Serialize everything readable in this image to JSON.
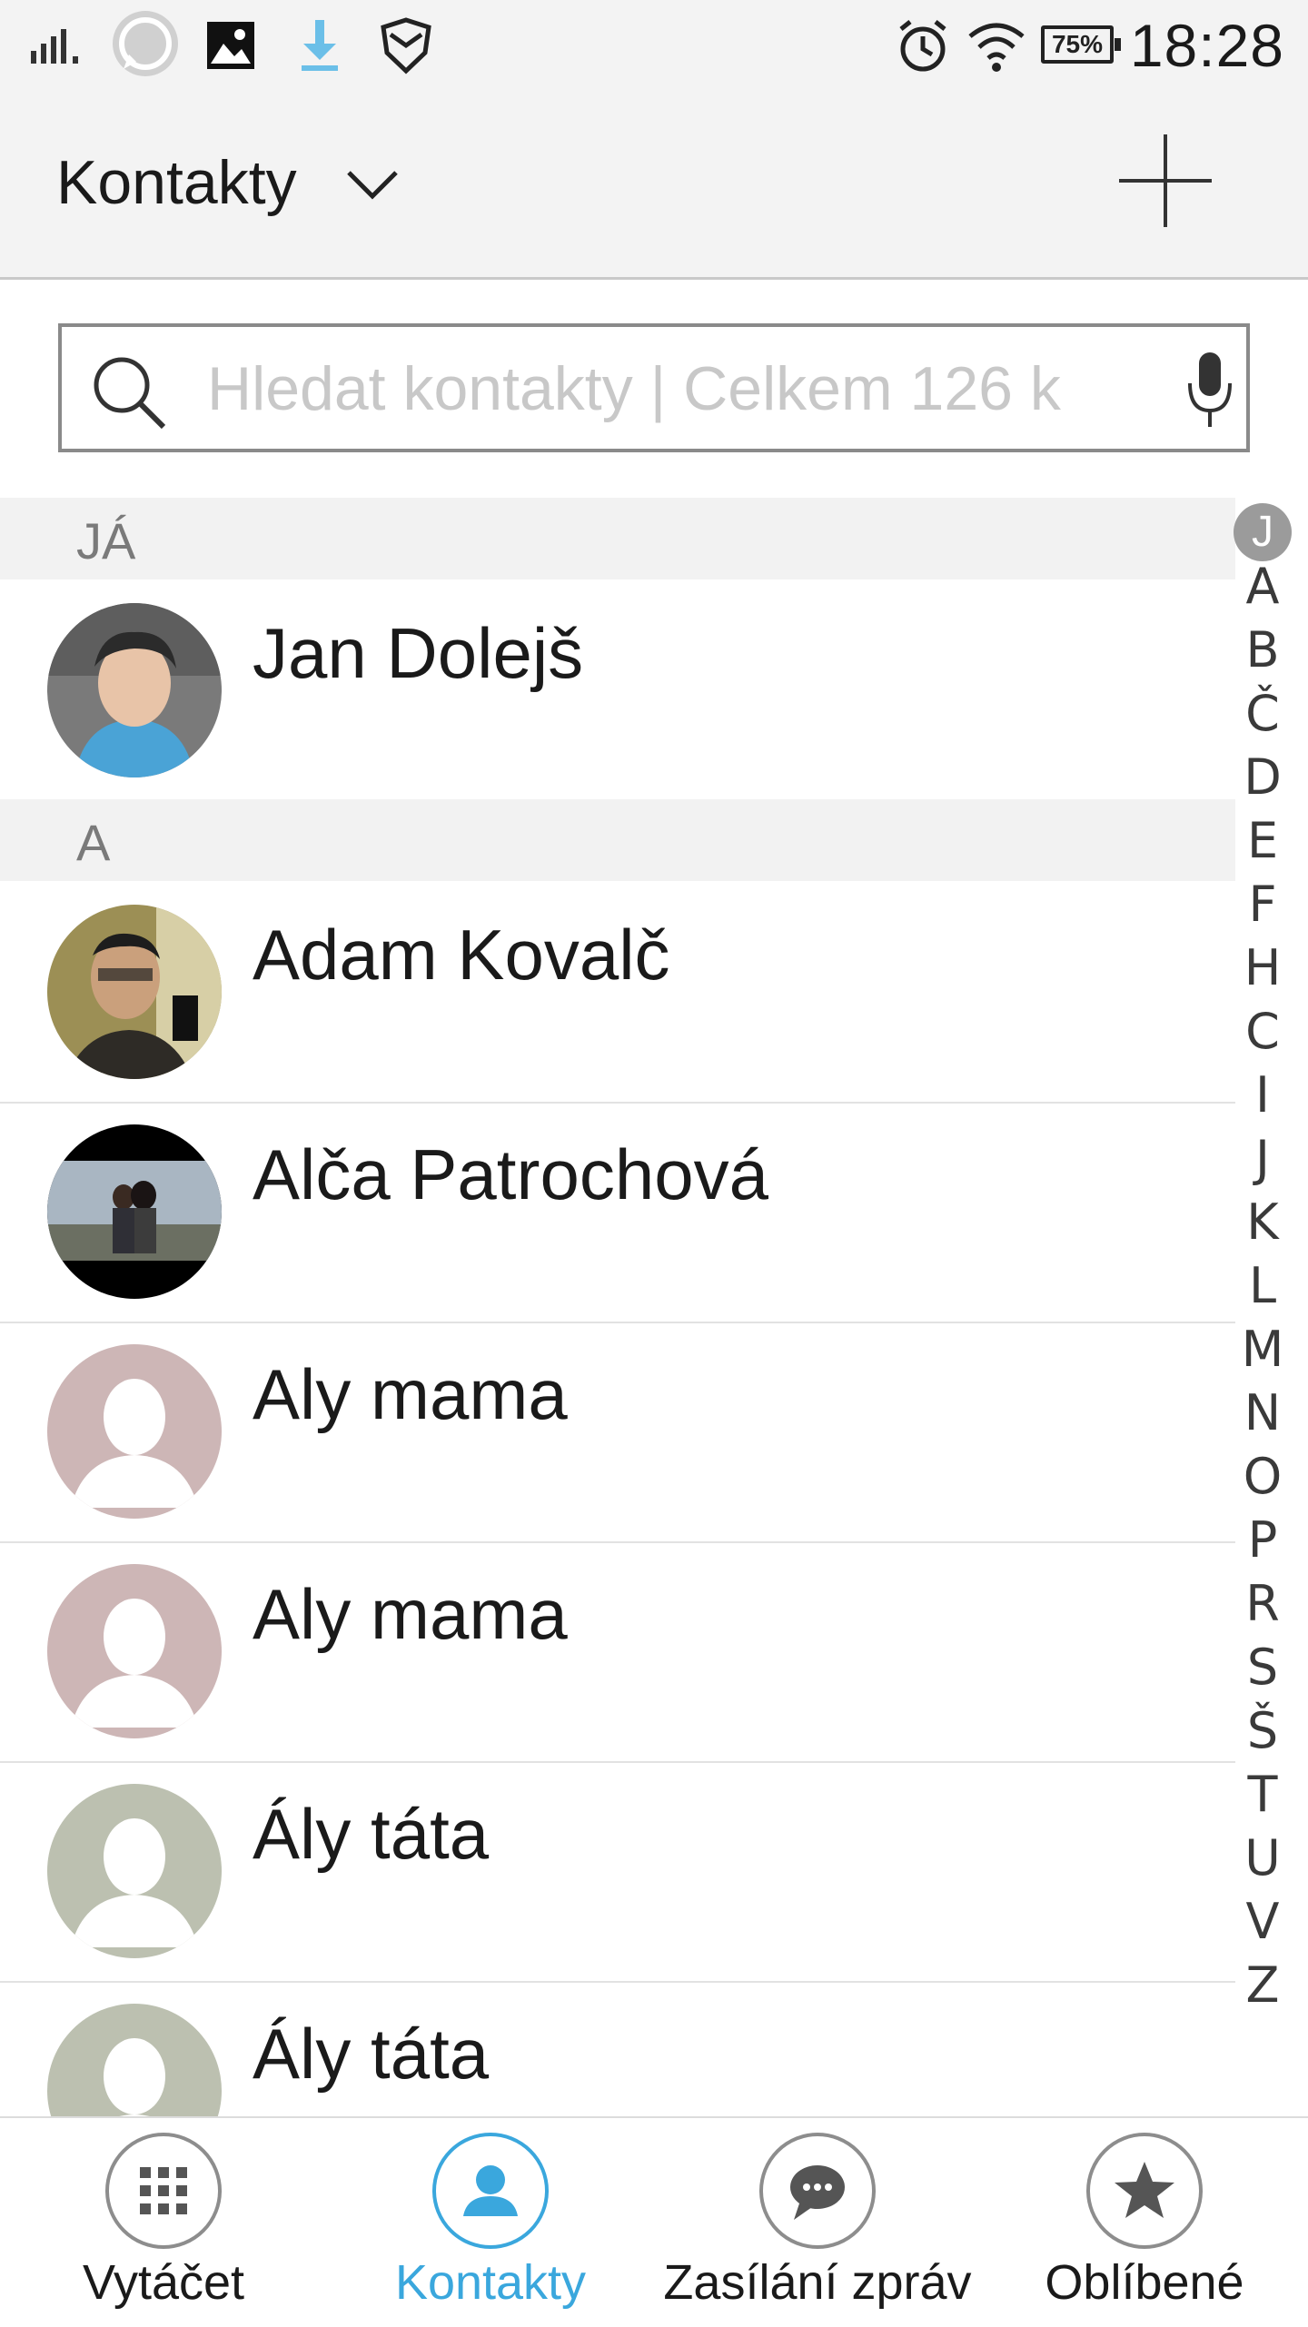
{
  "status_bar": {
    "time": "18:28",
    "battery": "75%",
    "icons": [
      "signal-icon",
      "whatsapp-icon",
      "image-icon",
      "download-icon",
      "shield-icon",
      "alarm-icon",
      "wifi-icon",
      "battery-icon"
    ]
  },
  "app_bar": {
    "title": "Kontakty",
    "dropdown_icon": "chevron-down-icon",
    "add_icon": "plus-icon"
  },
  "search": {
    "placeholder": "Hledat kontakty | Celkem 126 k",
    "value": ""
  },
  "sections": [
    {
      "header": "JÁ",
      "contacts": [
        {
          "name": "Jan Dolejš",
          "avatar": "photo"
        }
      ]
    },
    {
      "header": "A",
      "contacts": [
        {
          "name": "Adam Kovalč",
          "avatar": "photo"
        },
        {
          "name": "Alča Patrochová",
          "avatar": "photo"
        },
        {
          "name": "Aly mama",
          "avatar": "placeholder-pink"
        },
        {
          "name": "Aly mama",
          "avatar": "placeholder-pink"
        },
        {
          "name": "Ály táta",
          "avatar": "placeholder-green"
        },
        {
          "name": "Ály táta",
          "avatar": "placeholder-green"
        }
      ]
    }
  ],
  "alpha_index": {
    "active": "J",
    "letters": [
      "A",
      "B",
      "Č",
      "D",
      "E",
      "F",
      "H",
      "C",
      "I",
      "J",
      "K",
      "L",
      "M",
      "N",
      "O",
      "P",
      "R",
      "S",
      "Š",
      "T",
      "U",
      "V",
      "Z"
    ]
  },
  "bottom_nav": [
    {
      "label": "Vytáčet",
      "icon": "dialpad-icon",
      "active": false
    },
    {
      "label": "Kontakty",
      "icon": "person-icon",
      "active": true
    },
    {
      "label": "Zasílání zpráv",
      "icon": "message-icon",
      "active": false
    },
    {
      "label": "Oblíbené",
      "icon": "star-icon",
      "active": false
    }
  ],
  "colors": {
    "accent": "#3aa7dd",
    "avatar_pink": "#cdb6b6",
    "avatar_green": "#bcc0b0",
    "section_bg": "#f2f2f2"
  }
}
